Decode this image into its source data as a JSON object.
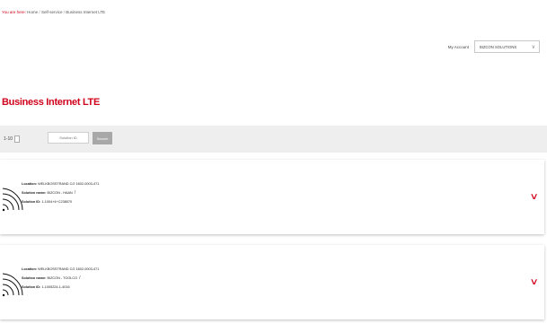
{
  "breadcrumb": {
    "prefix": "You are here:",
    "items": [
      "Home",
      "Self-service",
      "Business Internet LTE"
    ],
    "sep": "/"
  },
  "account": {
    "label": "My Account",
    "selected": "BIZCON SOLUTIONS"
  },
  "page": {
    "title": "Business Internet LTE"
  },
  "filter": {
    "range": "1-10",
    "placeholder": "Solution ID",
    "search_label": "Search"
  },
  "solutions": [
    {
      "location_label": "Location:",
      "location": "WELKBOSSTRAND C/2 1602-0003-471",
      "name_label": "Solution name:",
      "name": "BIZCON - HAAN",
      "id_label": "Solution ID:",
      "id": "1-1004+4+C238070"
    },
    {
      "location_label": "Location:",
      "location": "WELKBOSSTRAND C/2 1602-0003-471",
      "name_label": "Solution name:",
      "name": "BIZCON - TOOLCO",
      "id_label": "Solution ID:",
      "id": "1-1005224-1-4016"
    }
  ],
  "icons": {
    "signal": "wifi-signal-icon",
    "edit": "pencil-icon",
    "expand": "chevron-down-icon"
  },
  "colors": {
    "accent": "#d0021b",
    "filter_bg": "#eeeeee",
    "button_bg": "#a8a8a8"
  }
}
